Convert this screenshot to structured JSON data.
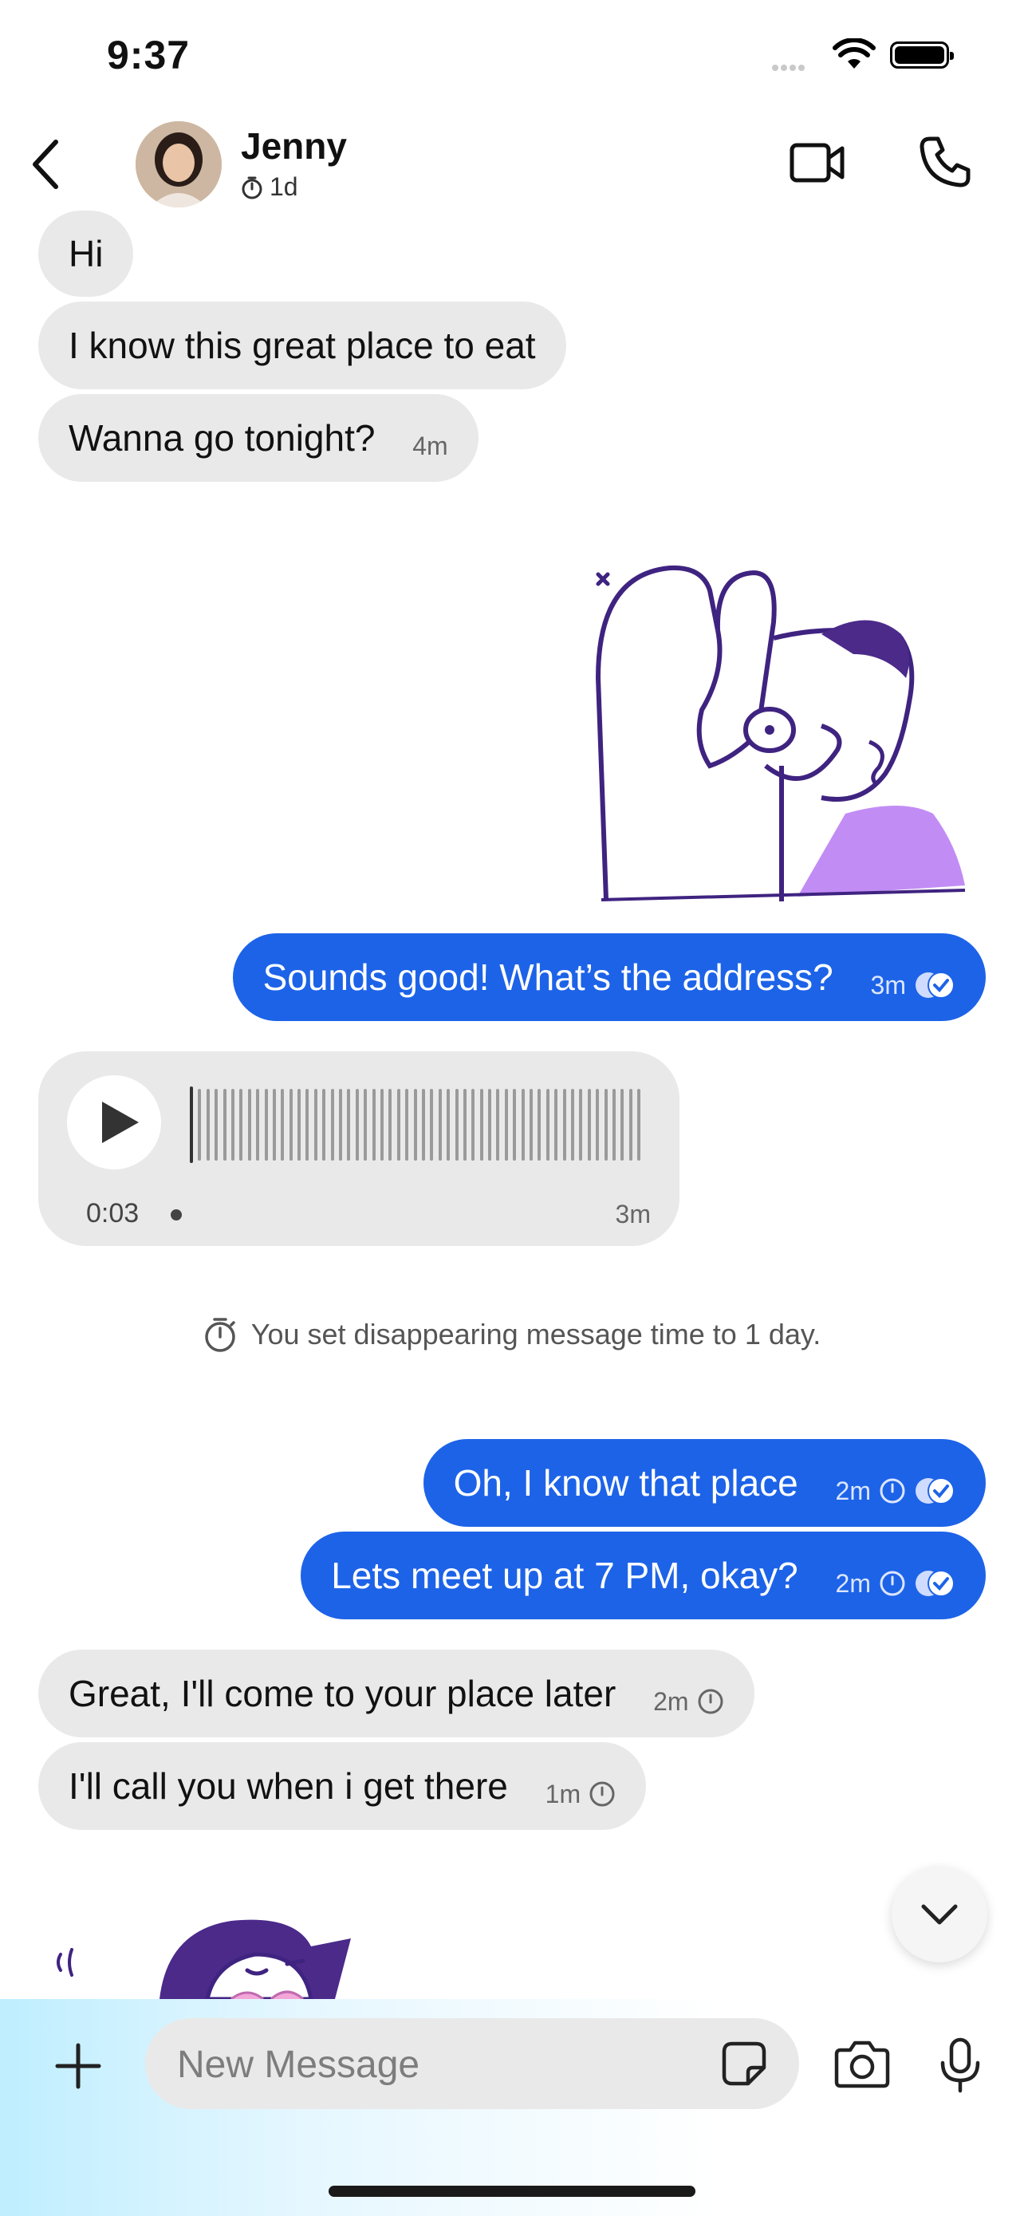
{
  "status_bar": {
    "time": "9:37"
  },
  "header": {
    "name": "Jenny",
    "timer": "1d"
  },
  "messages": {
    "m1": {
      "text": "Hi"
    },
    "m2": {
      "text": "I know this great place to eat"
    },
    "m3": {
      "text": "Wanna go tonight?",
      "time": "4m"
    },
    "m4": {
      "text": "Sounds good! What’s the address?",
      "time": "3m"
    },
    "voice": {
      "duration": "0:03",
      "time": "3m"
    },
    "system": {
      "text": "You set disappearing message time to 1 day."
    },
    "m5": {
      "text": "Oh, I know that place",
      "time": "2m"
    },
    "m6": {
      "text": "Lets meet up at 7 PM, okay?",
      "time": "2m"
    },
    "m7": {
      "text": "Great, I'll come to your place later",
      "time": "2m"
    },
    "m8": {
      "text": "I'll call you when i get there",
      "time": "1m"
    }
  },
  "composer": {
    "placeholder": "New Message"
  },
  "colors": {
    "outgoing": "#1d63e8",
    "incoming": "#e9e9e9",
    "sticker_purple": "#4b2a8a",
    "sticker_lilac": "#c28cf5"
  },
  "icons": [
    "back-icon",
    "timer-icon",
    "video-icon",
    "phone-icon",
    "read-receipt-icon",
    "play-icon",
    "stopwatch-icon",
    "chevron-down-icon",
    "plus-icon",
    "sticker-icon",
    "camera-icon",
    "mic-icon"
  ]
}
